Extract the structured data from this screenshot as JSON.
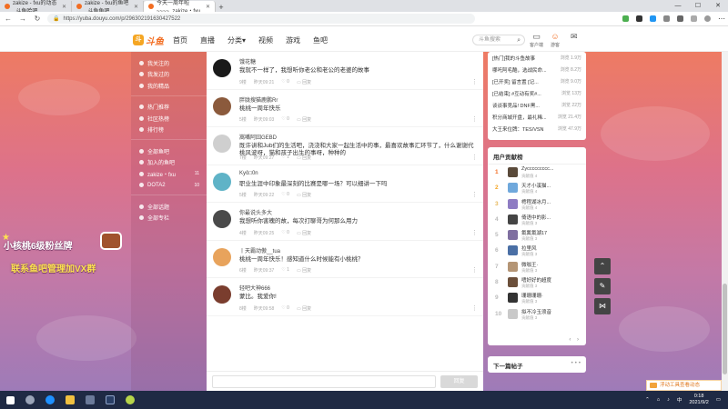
{
  "browser": {
    "tabs": [
      {
        "title": "zakize - fxu的动态_斗鱼哈吧",
        "active": false
      },
      {
        "title": "zakize - fxu的鱼吧_斗鱼鱼吧",
        "active": false
      },
      {
        "title": "今天一周年啦~~~~_zakize・fxu",
        "active": true
      }
    ],
    "new_tab": "+",
    "url": "https://yuba.douyu.com/p/296302191630427522"
  },
  "site": {
    "logo_text": "斗鱼",
    "nav": [
      "首页",
      "直播",
      "分类▾",
      "视频",
      "游戏",
      "鱼吧"
    ],
    "search_placeholder": "斗鱼搜索",
    "icons": {
      "client": "客户端",
      "download": "游客"
    }
  },
  "banner": {
    "line1": "小核桃6级粉丝牌",
    "line2": "联系鱼吧管理加VX群"
  },
  "sidebar": {
    "groups": [
      [
        {
          "label": "我关注的"
        },
        {
          "label": "我发过的"
        },
        {
          "label": "我的精品"
        }
      ],
      [
        {
          "label": "热门推荐"
        },
        {
          "label": "社区热榜"
        },
        {
          "label": "排行榜"
        }
      ],
      [
        {
          "label": "全部鱼吧"
        },
        {
          "label": "加入的鱼吧"
        },
        {
          "label": "zakize・fxu",
          "count": "11"
        },
        {
          "label": "DOTA2",
          "count": "10"
        }
      ],
      [
        {
          "label": "全部话题"
        },
        {
          "label": "全部专栏"
        }
      ]
    ]
  },
  "comments": [
    {
      "user": "饿花糖",
      "text": "我就不一样了，我想听你老公和老公的老婆的故事",
      "floor": "9楼",
      "time": "昨天09:21",
      "likes": "0",
      "reply": "回复",
      "avatar_color": "#1a1a1a"
    },
    {
      "user": "胖胧搜猫鹿鹏Rr",
      "text": "桃桃一周年快乐",
      "floor": "5楼",
      "time": "昨天09:03",
      "likes": "0",
      "reply": "回复",
      "avatar_color": "#8b5a3c"
    },
    {
      "user": "嵩嘴阿囧GEBD",
      "text": "既许讲和Jub们的生活吧，浇浇和大家一起生活中的事，最喜欢故事汇环节了，什么谢谢代桃风波呀，猫和孩子出生的事呀，种种的",
      "floor": "7楼",
      "time": "昨天09:27",
      "likes": "1",
      "reply": "回复",
      "avatar_color": "#cfcfcf"
    },
    {
      "user": "Kyô□0n",
      "text": "职业生涯中印象最深刻的比赛是哪一场？可以细讲一下吗",
      "floor": "5楼",
      "time": "昨天09:22",
      "likes": "0",
      "reply": "回复",
      "avatar_color": "#5fb3c7"
    },
    {
      "user": "你最说头多大",
      "text": "我想听你害魄的故，每次打聊哥为何那么用力",
      "floor": "4楼",
      "time": "昨天09:25",
      "likes": "0",
      "reply": "回复",
      "avatar_color": "#4a4a4a"
    },
    {
      "user": "丨天霸动傲__tua",
      "text": "桃桃一周年快乐！感知道什么时候能有小桃桃？",
      "floor": "6楼",
      "time": "昨天09:37",
      "likes": "1",
      "reply": "回复",
      "avatar_color": "#e8a35c"
    },
    {
      "user": "轻吧大神666",
      "text": "蒙比。我爱你!",
      "floor": "8楼",
      "time": "昨天09:58",
      "likes": "0",
      "reply": "回复",
      "avatar_color": "#7a3d2e"
    }
  ],
  "reply": {
    "button": "回复"
  },
  "topics": [
    {
      "title": "[热门]我的斗鱼故事",
      "views": "浏览 1.9万"
    },
    {
      "title": "哪吒阿毛酷，选战民命...",
      "views": "浏览 8.2万"
    },
    {
      "title": "[已开奖] 留言置 [记...",
      "views": "浏览 9.0万"
    },
    {
      "title": "[已结束] #互动有奖#...",
      "views": "浏览 13万"
    },
    {
      "title": "谈谈事竞品! DNF黑...",
      "views": "浏览 22万"
    },
    {
      "title": "积分商城开盘，最礼稀...",
      "views": "浏览 21.4万"
    },
    {
      "title": "大王来位牌：TES/VSN",
      "views": "浏览 47.9万"
    }
  ],
  "ranking": {
    "title": "用户贡献榜",
    "rows": [
      {
        "rank": "1",
        "name": "Zyccccccccc...",
        "sub": "贡献值 4",
        "color": "#5a4a3a"
      },
      {
        "rank": "2",
        "name": "天才小溪猫...",
        "sub": "贡献值 4",
        "color": "#6fa8dc"
      },
      {
        "rank": "3",
        "name": "樗程湖冰月...",
        "sub": "贡献值 4",
        "color": "#8e7cc3"
      },
      {
        "rank": "4",
        "name": "倚语中的影...",
        "sub": "贡献值 3",
        "color": "#444444"
      },
      {
        "rank": "5",
        "name": "氟氟氟湖17",
        "sub": "贡献值 3",
        "color": "#7f6fa0"
      },
      {
        "rank": "6",
        "name": "拉里风",
        "sub": "贡献值 3",
        "color": "#4a6fa5"
      },
      {
        "rank": "7",
        "name": "微咖王·",
        "sub": "贡献值 3",
        "color": "#b49575"
      },
      {
        "rank": "8",
        "name": "嗜好好的超度",
        "sub": "贡献值 3",
        "color": "#6b4f3a"
      },
      {
        "rank": "9",
        "name": "珊珊珊珊·",
        "sub": "贡献值 3",
        "color": "#333333"
      },
      {
        "rank": "10",
        "name": "拟不冷玉须音",
        "sub": "贡献值 3",
        "color": "#c9c9c9"
      }
    ],
    "pager_prev": "‹",
    "pager_next": "›"
  },
  "next_post": {
    "label": "下一篇帖子",
    "dots": "• • •"
  },
  "toast": {
    "text": "浮动工具查看动态"
  },
  "taskbar": {
    "time": "0:18",
    "date": "2021/9/2",
    "lang": "中"
  }
}
